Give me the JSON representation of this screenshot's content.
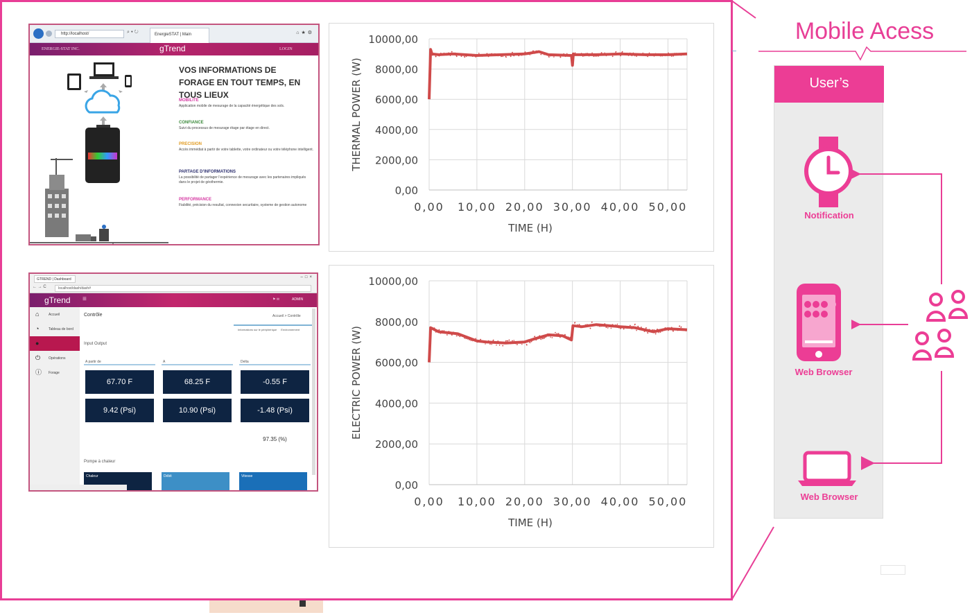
{
  "colors": {
    "accent": "#e83e96",
    "series": "#cf4a4a",
    "navy": "#0e2442"
  },
  "mobile_panel": {
    "title": "Mobile Acess",
    "header": "User’s",
    "devices": [
      {
        "icon": "watch-icon",
        "label": "Notification"
      },
      {
        "icon": "smartphone-icon",
        "label": "Web Browser"
      },
      {
        "icon": "laptop-icon",
        "label": "Web Browser"
      }
    ],
    "group_icon": "users-group-icon"
  },
  "website": {
    "url": "http://localhost/",
    "tab": "EnergieSTAT | Main",
    "company": "ENERGIE-STAT INC.",
    "logo": "gTrend",
    "login": "LOGIN",
    "heading": "VOS INFORMATIONS DE FORAGE EN TOUT TEMPS, EN TOUS LIEUX",
    "features": [
      {
        "title": "MOBILITE",
        "color": "#d63ba3",
        "desc": "Application mobile de mesurage de la capacité énergétique des sols."
      },
      {
        "title": "CONFIANCE",
        "color": "#3c8a3c",
        "desc": "Suivi du processus de mesurage étage par étage en direct."
      },
      {
        "title": "PRECISION",
        "color": "#e19b22",
        "desc": "Accès immédiat à partir de votre tablette, votre ordinateur ou votre téléphone intelligent."
      },
      {
        "title": "PARTAGE D’INFORMATIONS",
        "color": "#2b2e6e",
        "desc": "La possibilité de partager l’expérience de mesurage avec les partenaires impliqués dans le projet de géothermie."
      },
      {
        "title": "PERFORMANCE",
        "color": "#d63ba3",
        "desc": "Fiabilité, précision du resultat, connexion securitaire, systeme de gestion autonome"
      }
    ]
  },
  "dashboard": {
    "tab": "GTREND | Dashboard",
    "url": "localhost/dash/dash#",
    "logo": "gTrend",
    "user": "ADMIN",
    "nav": [
      "Accueil",
      "Tableau de bord",
      "",
      "Opérations",
      "Forage"
    ],
    "page_title": "Contrôle",
    "breadcrumb": "Accueil > Contrôle",
    "subtabs": [
      "Informations sur le périphérique",
      "Environnement"
    ],
    "section_input": "Input Output",
    "columns": [
      "A partir de",
      "A",
      "Delta"
    ],
    "values": [
      [
        "67.70 F",
        "68.25 F",
        "-0.55 F"
      ],
      [
        "9.42 (Psi)",
        "10.90 (Psi)",
        "-1.48 (Psi)"
      ]
    ],
    "efficiency": "97.35 (%)",
    "section_pump": "Pompe à chaleur",
    "pump_cards": [
      {
        "label": "Chaleur",
        "color": "#0e2442"
      },
      {
        "label": "Débit",
        "color": "#3d8fc6"
      },
      {
        "label": "Vitesse",
        "color": "#1a6fb8"
      }
    ]
  },
  "chart_data": [
    {
      "type": "line",
      "xlabel": "TIME (H)",
      "ylabel": "THERMAL POWER (W)",
      "xlim": [
        0,
        54
      ],
      "ylim": [
        0,
        10000
      ],
      "xticks": [
        "0,00",
        "10,00",
        "20,00",
        "30,00",
        "40,00",
        "50,00"
      ],
      "yticks": [
        "0,00",
        "2000,00",
        "4000,00",
        "6000,00",
        "8000,00",
        "10000,00"
      ],
      "grid": true,
      "series": [
        {
          "x": [
            0,
            0.3,
            0.6,
            2,
            5,
            10,
            15,
            20,
            23,
            25,
            29.8,
            30,
            30.2,
            30.5,
            35,
            40,
            45,
            50,
            54
          ],
          "y": [
            6000,
            9300,
            9000,
            8950,
            9000,
            8900,
            8950,
            9000,
            9150,
            8950,
            8900,
            8250,
            9000,
            8950,
            8950,
            9000,
            8950,
            8950,
            9000
          ]
        }
      ]
    },
    {
      "type": "line",
      "xlabel": "TIME (H)",
      "ylabel": "ELECTRIC POWER (W)",
      "xlim": [
        0,
        54
      ],
      "ylim": [
        0,
        10000
      ],
      "xticks": [
        "0,00",
        "10,00",
        "20,00",
        "30,00",
        "40,00",
        "50,00"
      ],
      "yticks": [
        "0,00",
        "2000,00",
        "4000,00",
        "6000,00",
        "8000,00",
        "10000,00"
      ],
      "grid": true,
      "series": [
        {
          "x": [
            0,
            0.3,
            2,
            6,
            10,
            12,
            16,
            20,
            22,
            25,
            28,
            29.8,
            30.1,
            32,
            35,
            40,
            43,
            47,
            50,
            54
          ],
          "y": [
            6000,
            7700,
            7500,
            7400,
            7050,
            7000,
            6950,
            7000,
            7150,
            7350,
            7300,
            7100,
            7800,
            7750,
            7850,
            7750,
            7700,
            7500,
            7650,
            7600
          ]
        }
      ]
    }
  ]
}
